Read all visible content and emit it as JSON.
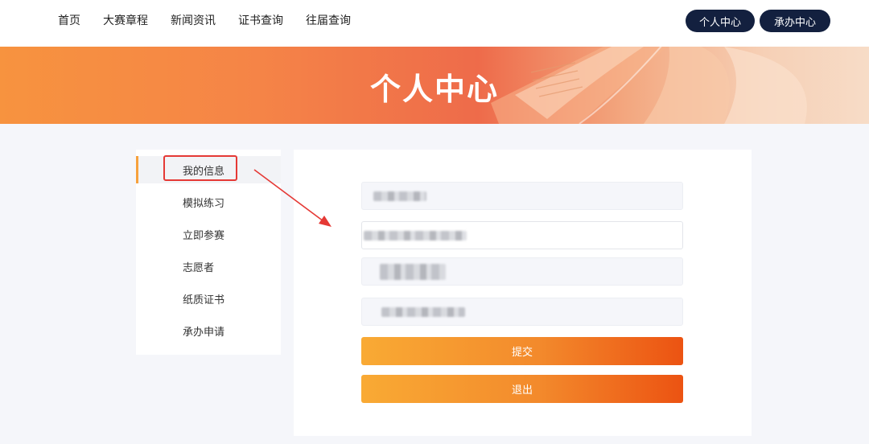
{
  "nav": {
    "items": [
      "首页",
      "大赛章程",
      "新闻资讯",
      "证书查询",
      "往届查询"
    ],
    "personal_center_button": "个人中心",
    "host_center_button": "承办中心"
  },
  "banner": {
    "title": "个人中心"
  },
  "sidebar": {
    "items": [
      {
        "label": "我的信息",
        "active": true
      },
      {
        "label": "模拟练习"
      },
      {
        "label": "立即参赛"
      },
      {
        "label": "志愿者"
      },
      {
        "label": "纸质证书"
      },
      {
        "label": "承办申请"
      }
    ]
  },
  "form": {
    "submit_label": "提交",
    "logout_label": "退出"
  },
  "colors": {
    "accent_orange": "#f38a2c",
    "nav_button_bg": "#13203f",
    "annotation_red": "#e53935"
  }
}
